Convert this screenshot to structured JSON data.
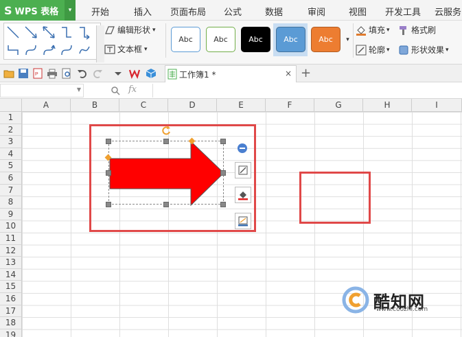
{
  "app": {
    "logo_text": "WPS 表格",
    "logo_glyph": "S",
    "logo_dropdown": "▾"
  },
  "menu": [
    "开始",
    "插入",
    "页面布局",
    "公式",
    "数据",
    "审阅",
    "视图",
    "开发工具",
    "云服务"
  ],
  "ribbon": {
    "edit_shape_label": "编辑形状",
    "textbox_label": "文本框",
    "style_samples": [
      "Abc",
      "Abc",
      "Abc",
      "Abc",
      "Abc"
    ],
    "fill_label": "填充",
    "outline_label": "轮廓",
    "format_painter_label": "格式刷",
    "shape_effects_label": "形状效果",
    "dropdown": "▾",
    "more": "▾"
  },
  "colors": {
    "accent_green": "#4caf50",
    "arrow_red": "#ff0000",
    "annotation_red": "#e04848",
    "style_blue": "#5b9bd5",
    "style_orange": "#ed7d31",
    "style_black": "#000000"
  },
  "tabs": {
    "document_label": "工作簿1 *",
    "close_glyph": "×",
    "new_tab_glyph": "+"
  },
  "formula_bar": {
    "name_box_value": "",
    "fx_label": "fx",
    "formula_value": ""
  },
  "grid": {
    "columns": [
      "A",
      "B",
      "C",
      "D",
      "E",
      "F",
      "G",
      "H",
      "I"
    ],
    "rows": [
      "1",
      "2",
      "3",
      "4",
      "5",
      "6",
      "7",
      "8",
      "9",
      "10",
      "11",
      "12",
      "13",
      "14",
      "15",
      "16",
      "17",
      "18",
      "19"
    ]
  },
  "watermark": {
    "title": "酷知网",
    "url": "www.coozhi.com"
  }
}
